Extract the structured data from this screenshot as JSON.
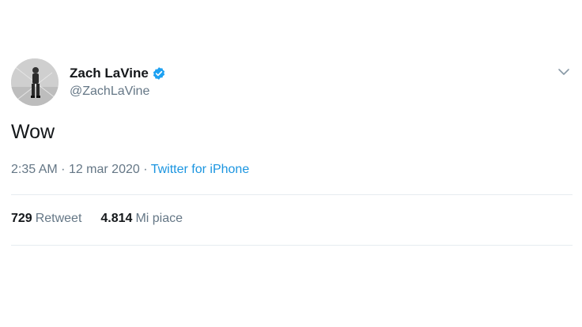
{
  "user": {
    "display_name": "Zach LaVine",
    "handle": "@ZachLaVine",
    "verified": true
  },
  "tweet": {
    "text": "Wow",
    "time": "2:35 AM",
    "separator": "·",
    "date": "12 mar 2020",
    "source": "Twitter for iPhone"
  },
  "stats": {
    "retweets_count": "729",
    "retweets_label": "Retweet",
    "likes_count": "4.814",
    "likes_label": "Mi piace"
  },
  "icons": {
    "verified": "verified-badge-icon",
    "menu": "chevron-down-icon"
  },
  "colors": {
    "verified_blue": "#1da1f2",
    "link_blue": "#1b95e0",
    "secondary_text": "#657786",
    "primary_text": "#14171a",
    "divider": "#e6ecf0"
  }
}
